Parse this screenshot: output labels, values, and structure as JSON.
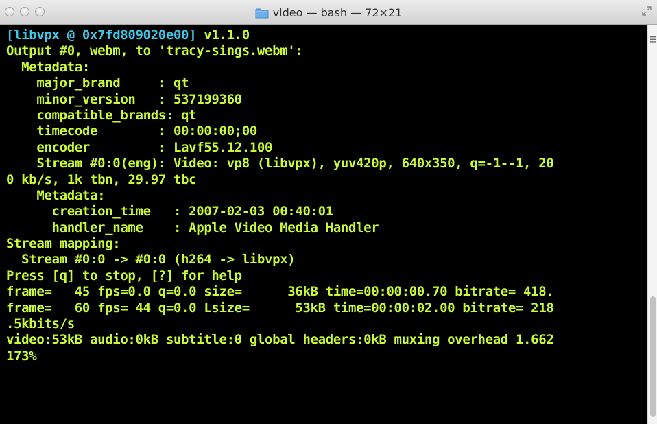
{
  "window": {
    "title": "video — bash — 72×21",
    "folder_icon": "folder-icon",
    "accent_color": "#c8fa3a",
    "highlight_color": "#3ec7e6",
    "background_color": "#000000"
  },
  "terminal": {
    "line_0_cyan": "[libvpx @ 0x7fd809020e00]",
    "line_0_rest": " v1.1.0",
    "lines": [
      "Output #0, webm, to 'tracy-sings.webm':",
      "  Metadata:",
      "    major_brand     : qt",
      "    minor_version   : 537199360",
      "    compatible_brands: qt",
      "    timecode        : 00:00:00;00",
      "    encoder         : Lavf55.12.100",
      "    Stream #0:0(eng): Video: vp8 (libvpx), yuv420p, 640x350, q=-1--1, 20",
      "0 kb/s, 1k tbn, 29.97 tbc",
      "    Metadata:",
      "      creation_time   : 2007-02-03 00:40:01",
      "      handler_name    : Apple Video Media Handler",
      "Stream mapping:",
      "  Stream #0:0 -> #0:0 (h264 -> libvpx)",
      "Press [q] to stop, [?] for help",
      "frame=   45 fps=0.0 q=0.0 size=      36kB time=00:00:00.70 bitrate= 418.",
      "frame=   60 fps= 44 q=0.0 Lsize=      53kB time=00:00:02.00 bitrate= 218",
      ".5kbits/s",
      "video:53kB audio:0kB subtitle:0 global headers:0kB muxing overhead 1.662",
      "173%"
    ]
  },
  "scrollbar": {
    "position_fraction": 0.7
  }
}
